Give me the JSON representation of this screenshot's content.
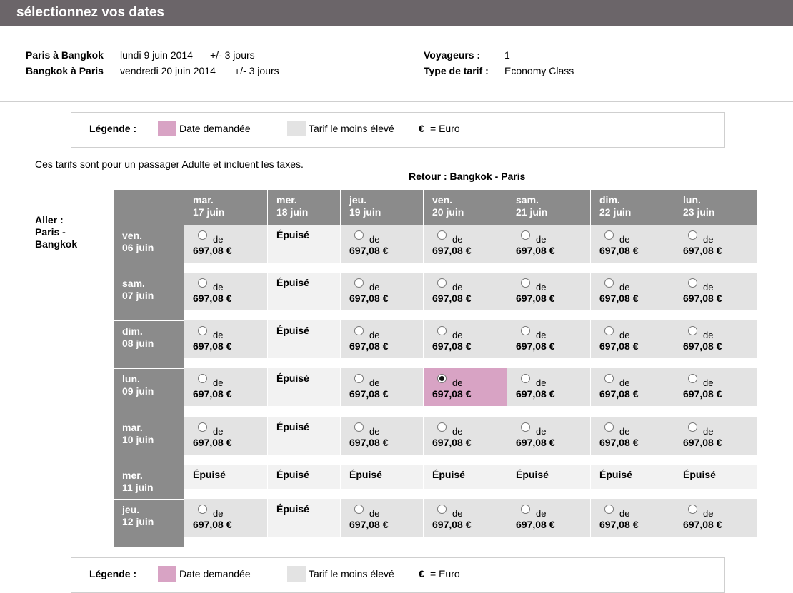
{
  "header": {
    "title": "sélectionnez vos dates"
  },
  "trip": {
    "outbound": {
      "route": "Paris à Bangkok",
      "date": "lundi 9 juin 2014",
      "flex": "+/- 3 jours"
    },
    "inbound": {
      "route": "Bangkok à Paris",
      "date": "vendredi 20 juin 2014",
      "flex": "+/- 3 jours"
    },
    "travelers_label": "Voyageurs :",
    "travelers_value": "1",
    "fare_label": "Type de tarif :",
    "fare_value": "Economy Class"
  },
  "legend": {
    "title": "Légende :",
    "requested": "Date demandée",
    "lowest": "Tarif le moins élevé",
    "currency_symbol": "€",
    "currency_text": "= Euro",
    "requested_color": "#d8a3c4",
    "lowest_color": "#e3e3e3"
  },
  "note": "Ces tarifs sont pour un passager Adulte et incluent les taxes.",
  "return_label": "Retour : Bangkok - Paris",
  "outbound_label": {
    "line1": "Aller :",
    "line2": "Paris -",
    "line3": "Bangkok"
  },
  "columns": [
    {
      "day": "mar.",
      "date": "17 juin"
    },
    {
      "day": "mer.",
      "date": "18 juin"
    },
    {
      "day": "jeu.",
      "date": "19 juin"
    },
    {
      "day": "ven.",
      "date": "20 juin"
    },
    {
      "day": "sam.",
      "date": "21 juin"
    },
    {
      "day": "dim.",
      "date": "22 juin"
    },
    {
      "day": "lun.",
      "date": "23 juin"
    }
  ],
  "rows": [
    {
      "day": "ven.",
      "date": "06 juin",
      "cells": [
        {
          "status": "available",
          "from": "de",
          "price": "697,08 €"
        },
        {
          "status": "soldout",
          "text": "Épuisé"
        },
        {
          "status": "available",
          "from": "de",
          "price": "697,08 €"
        },
        {
          "status": "available",
          "from": "de",
          "price": "697,08 €"
        },
        {
          "status": "available",
          "from": "de",
          "price": "697,08 €"
        },
        {
          "status": "available",
          "from": "de",
          "price": "697,08 €"
        },
        {
          "status": "available",
          "from": "de",
          "price": "697,08 €"
        }
      ]
    },
    {
      "day": "sam.",
      "date": "07 juin",
      "cells": [
        {
          "status": "available",
          "from": "de",
          "price": "697,08 €"
        },
        {
          "status": "soldout",
          "text": "Épuisé"
        },
        {
          "status": "available",
          "from": "de",
          "price": "697,08 €"
        },
        {
          "status": "available",
          "from": "de",
          "price": "697,08 €"
        },
        {
          "status": "available",
          "from": "de",
          "price": "697,08 €"
        },
        {
          "status": "available",
          "from": "de",
          "price": "697,08 €"
        },
        {
          "status": "available",
          "from": "de",
          "price": "697,08 €"
        }
      ]
    },
    {
      "day": "dim.",
      "date": "08 juin",
      "cells": [
        {
          "status": "available",
          "from": "de",
          "price": "697,08 €"
        },
        {
          "status": "soldout",
          "text": "Épuisé"
        },
        {
          "status": "available",
          "from": "de",
          "price": "697,08 €"
        },
        {
          "status": "available",
          "from": "de",
          "price": "697,08 €"
        },
        {
          "status": "available",
          "from": "de",
          "price": "697,08 €"
        },
        {
          "status": "available",
          "from": "de",
          "price": "697,08 €"
        },
        {
          "status": "available",
          "from": "de",
          "price": "697,08 €"
        }
      ]
    },
    {
      "day": "lun.",
      "date": "09 juin",
      "cells": [
        {
          "status": "available",
          "from": "de",
          "price": "697,08 €"
        },
        {
          "status": "soldout",
          "text": "Épuisé"
        },
        {
          "status": "available",
          "from": "de",
          "price": "697,08 €"
        },
        {
          "status": "selected",
          "from": "de",
          "price": "697,08 €"
        },
        {
          "status": "available",
          "from": "de",
          "price": "697,08 €"
        },
        {
          "status": "available",
          "from": "de",
          "price": "697,08 €"
        },
        {
          "status": "available",
          "from": "de",
          "price": "697,08 €"
        }
      ]
    },
    {
      "day": "mar.",
      "date": "10 juin",
      "cells": [
        {
          "status": "available",
          "from": "de",
          "price": "697,08 €"
        },
        {
          "status": "soldout",
          "text": "Épuisé"
        },
        {
          "status": "available",
          "from": "de",
          "price": "697,08 €"
        },
        {
          "status": "available",
          "from": "de",
          "price": "697,08 €"
        },
        {
          "status": "available",
          "from": "de",
          "price": "697,08 €"
        },
        {
          "status": "available",
          "from": "de",
          "price": "697,08 €"
        },
        {
          "status": "available",
          "from": "de",
          "price": "697,08 €"
        }
      ]
    },
    {
      "day": "mer.",
      "date": "11 juin",
      "cells": [
        {
          "status": "soldout",
          "text": "Épuisé"
        },
        {
          "status": "soldout",
          "text": "Épuisé"
        },
        {
          "status": "soldout",
          "text": "Épuisé"
        },
        {
          "status": "soldout",
          "text": "Épuisé"
        },
        {
          "status": "soldout",
          "text": "Épuisé"
        },
        {
          "status": "soldout",
          "text": "Épuisé"
        },
        {
          "status": "soldout",
          "text": "Épuisé"
        }
      ]
    },
    {
      "day": "jeu.",
      "date": "12 juin",
      "cells": [
        {
          "status": "available",
          "from": "de",
          "price": "697,08 €"
        },
        {
          "status": "soldout",
          "text": "Épuisé"
        },
        {
          "status": "available",
          "from": "de",
          "price": "697,08 €"
        },
        {
          "status": "available",
          "from": "de",
          "price": "697,08 €"
        },
        {
          "status": "available",
          "from": "de",
          "price": "697,08 €"
        },
        {
          "status": "available",
          "from": "de",
          "price": "697,08 €"
        },
        {
          "status": "available",
          "from": "de",
          "price": "697,08 €"
        }
      ]
    }
  ]
}
